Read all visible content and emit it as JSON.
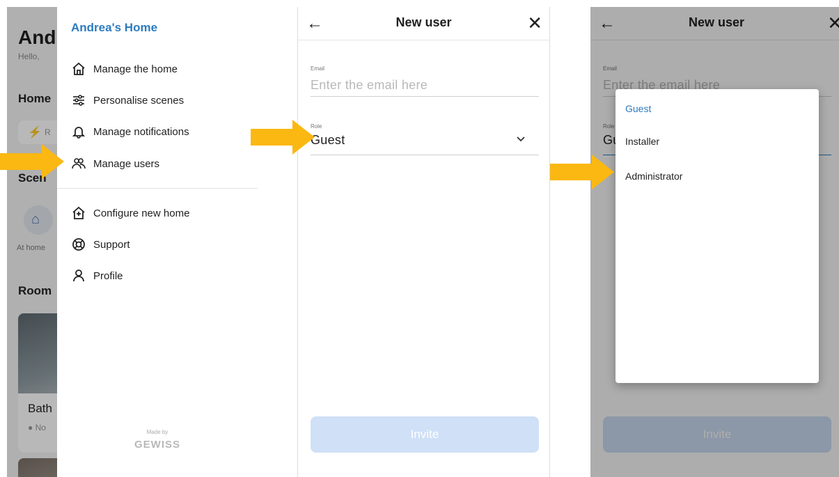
{
  "screen1": {
    "background": {
      "title": "And",
      "hello": "Hello,",
      "section_home": "Home",
      "chip_text": "R",
      "section_scenes": "Scen",
      "scene_label": "At home",
      "section_rooms": "Room",
      "room_name": "Bath",
      "room_status": "● No"
    },
    "drawer": {
      "title": "Andrea's Home",
      "items": [
        {
          "label": "Manage the home",
          "icon": "home-icon"
        },
        {
          "label": "Personalise scenes",
          "icon": "sliders-icon"
        },
        {
          "label": "Manage notifications",
          "icon": "bell-icon"
        },
        {
          "label": "Manage users",
          "icon": "users-icon"
        },
        {
          "label": "Configure new home",
          "icon": "add-home-icon"
        },
        {
          "label": "Support",
          "icon": "lifebuoy-icon"
        },
        {
          "label": "Profile",
          "icon": "user-icon"
        }
      ],
      "made_by": "Made by",
      "brand": "GEWISS"
    }
  },
  "screen2": {
    "title": "New user",
    "email_label": "Email",
    "email_placeholder": "Enter the email here",
    "role_label": "Role",
    "role_value": "Guest",
    "invite_label": "Invite"
  },
  "screen3": {
    "title": "New user",
    "email_label": "Email",
    "email_placeholder": "Enter the email here",
    "role_label": "Role",
    "role_value": "Gu",
    "invite_label": "Invite",
    "options": [
      "Guest",
      "Installer",
      "Administrator"
    ],
    "selected": "Guest"
  },
  "colors": {
    "accent": "#2c7bc0",
    "arrow": "#fbb813",
    "invite_disabled": "#cfe0f7"
  }
}
